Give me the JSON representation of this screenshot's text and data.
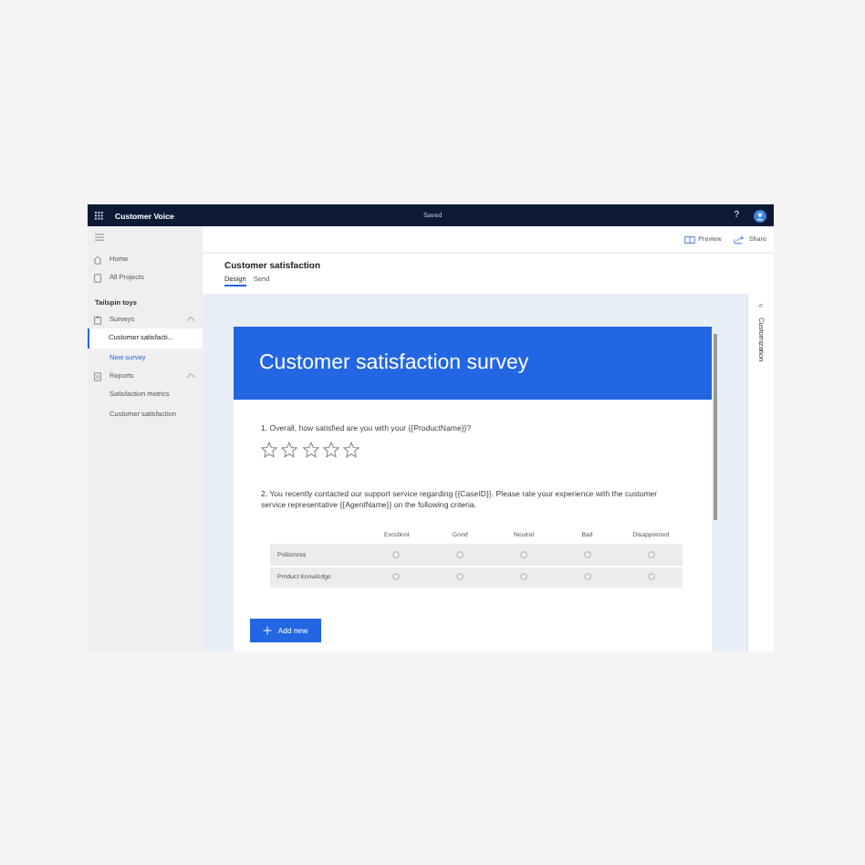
{
  "top_bar": {
    "app_name": "Customer Voice",
    "status": "Saved",
    "help": "?"
  },
  "sidebar": {
    "nav": [
      {
        "label": "Home"
      },
      {
        "label": "All Projects"
      }
    ],
    "project": "Tailspin toys",
    "groups": [
      {
        "label": "Surveys",
        "expanded": true,
        "children": [
          {
            "label": "Customer satisfacti...",
            "selected": true
          },
          {
            "label": "New survey",
            "selected": false,
            "kind": "link"
          }
        ]
      },
      {
        "label": "Reports",
        "expanded": true,
        "children": [
          {
            "label": "Satisfaction metrics",
            "selected": false
          },
          {
            "label": "Customer satisfaction",
            "selected": false
          }
        ]
      }
    ]
  },
  "toolbar": [
    {
      "label": "Preview"
    },
    {
      "label": "Share"
    }
  ],
  "page": {
    "title": "Customer satisfaction",
    "tabs": [
      {
        "label": "Design",
        "selected": true
      },
      {
        "label": "Send",
        "selected": false
      }
    ]
  },
  "survey": {
    "title": "Customer satisfaction survey",
    "questions": [
      {
        "kind": "rating",
        "text": "1. Overall, how satisfied are you with your {{ProductName}}?",
        "stars": 0
      },
      {
        "kind": "matrix",
        "text": "2. You recently contacted our support service regarding {{CaseID}}. Please rate your experience with the customer service representative {{AgentName}} on the following criteria.",
        "columns": [
          "Excellent",
          "Good",
          "Neutral",
          "Bad",
          "Disappointed"
        ],
        "rows": [
          {
            "label": "Politeness",
            "cells": [
              {
                "selected": false
              },
              {
                "selected": false
              },
              {
                "selected": false
              },
              {
                "selected": false
              },
              {
                "selected": false
              }
            ]
          },
          {
            "label": "Product Knowledge",
            "cells": [
              {
                "selected": false
              },
              {
                "selected": false
              },
              {
                "selected": false
              },
              {
                "selected": false
              },
              {
                "selected": false
              }
            ]
          }
        ]
      }
    ],
    "add_button": "Add new"
  },
  "side_panel": {
    "title": "Customization",
    "collapse": "<"
  }
}
